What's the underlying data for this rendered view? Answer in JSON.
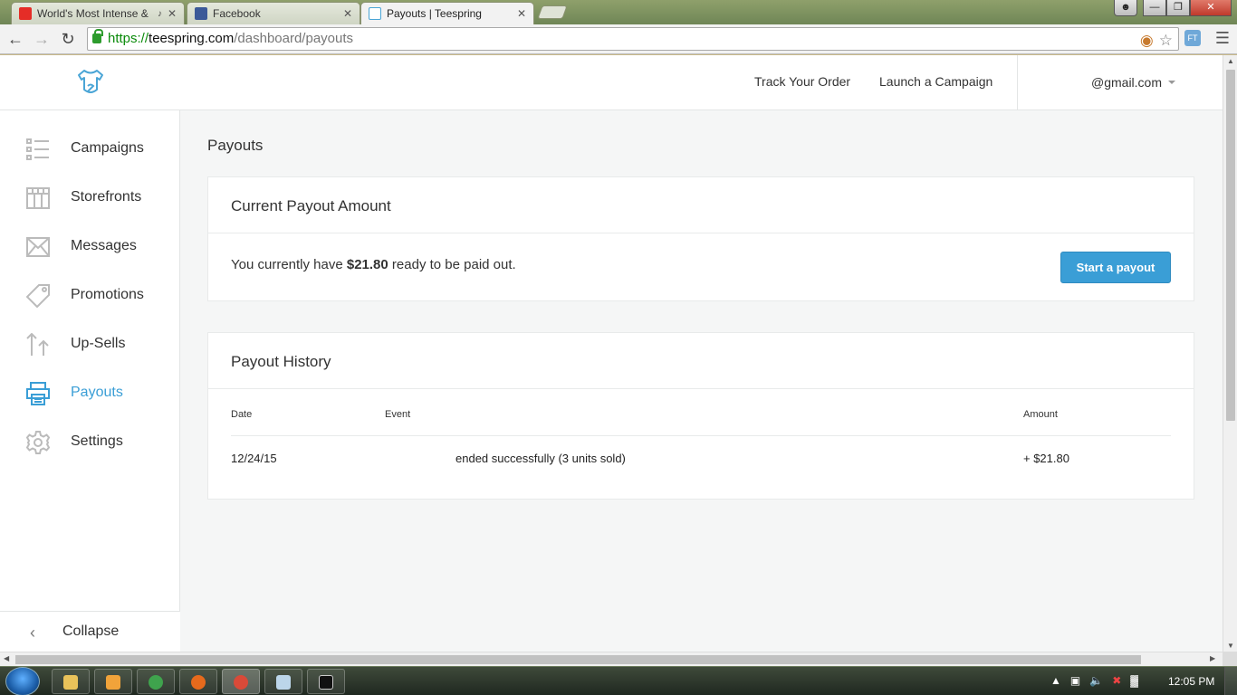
{
  "browser": {
    "tabs": [
      {
        "title": "World's Most Intense &",
        "favicon": "youtube-icon"
      },
      {
        "title": "Facebook",
        "favicon": "facebook-icon"
      },
      {
        "title": "Payouts | Teespring",
        "favicon": "teespring-icon",
        "active": true
      }
    ],
    "url": {
      "scheme": "https://",
      "host": "teespring.com",
      "path": "/dashboard/payouts"
    }
  },
  "header": {
    "links": [
      "Track Your Order",
      "Launch a Campaign"
    ],
    "account": "@gmail.com"
  },
  "sidebar": {
    "items": [
      {
        "label": "Campaigns",
        "icon": "list-icon"
      },
      {
        "label": "Storefronts",
        "icon": "storefront-icon"
      },
      {
        "label": "Messages",
        "icon": "envelope-icon"
      },
      {
        "label": "Promotions",
        "icon": "tag-icon"
      },
      {
        "label": "Up-Sells",
        "icon": "upsell-arrows-icon"
      },
      {
        "label": "Payouts",
        "icon": "payouts-icon",
        "active": true
      },
      {
        "label": "Settings",
        "icon": "gear-icon"
      }
    ],
    "collapse_label": "Collapse"
  },
  "main": {
    "page_title": "Payouts",
    "current": {
      "title": "Current Payout Amount",
      "text_before": "You currently have ",
      "amount": "$21.80",
      "text_after": " ready to be paid out.",
      "button": "Start a payout"
    },
    "history": {
      "title": "Payout History",
      "columns": [
        "Date",
        "Event",
        "Amount"
      ],
      "rows": [
        {
          "date": "12/24/15",
          "event": "ended successfully (3 units sold)",
          "amount": "+ $21.80"
        }
      ]
    }
  },
  "taskbar": {
    "clock": "12:05 PM"
  },
  "colors": {
    "accent": "#3a9ed6",
    "text": "#333333",
    "background": "#f5f6f6"
  }
}
